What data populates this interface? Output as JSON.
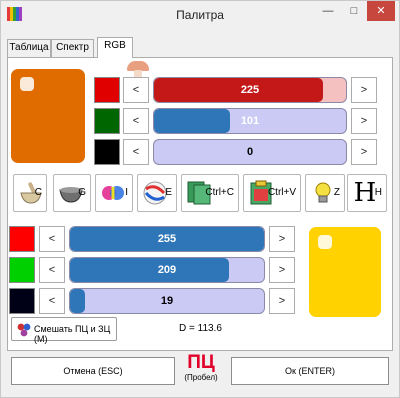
{
  "window": {
    "title": "Палитра",
    "minimize_glyph": "—",
    "maximize_glyph": "□",
    "close_glyph": "✕"
  },
  "tabs": [
    {
      "label": "Таблица",
      "active": false
    },
    {
      "label": "Спектр",
      "active": false
    },
    {
      "label": "RGB",
      "active": true
    }
  ],
  "primary": {
    "swatch_color": "#e06c00",
    "channels": [
      {
        "name": "red",
        "swatch_color": "#e00000",
        "value": "225",
        "fraction": 0.882,
        "fill_color": "#c41818",
        "track_color": "#f4c0c0",
        "text_color": "#ffffff"
      },
      {
        "name": "green",
        "swatch_color": "#006600",
        "value": "101",
        "fraction": 0.396,
        "fill_color": "#2e76b8",
        "track_color": "#cacaf4",
        "text_color": "#ffffff"
      },
      {
        "name": "blue",
        "swatch_color": "#000000",
        "value": "0",
        "fraction": 0.0,
        "fill_color": "#2e76b8",
        "track_color": "#cacaf4",
        "text_color": "#000000"
      }
    ]
  },
  "secondary": {
    "swatch_color": "#ffd200",
    "channels": [
      {
        "name": "red",
        "swatch_color": "#ff0000",
        "value": "255",
        "fraction": 1.0,
        "fill_color": "#2e76b8",
        "track_color": "#cacaf4",
        "text_color": "#ffffff"
      },
      {
        "name": "green",
        "swatch_color": "#00d000",
        "value": "209",
        "fraction": 0.82,
        "fill_color": "#2e76b8",
        "track_color": "#cacaf4",
        "text_color": "#ffffff"
      },
      {
        "name": "blue",
        "swatch_color": "#000016",
        "value": "19",
        "fraction": 0.075,
        "fill_color": "#2e76b8",
        "track_color": "#cacaf4",
        "text_color": "#000000"
      }
    ]
  },
  "arrows": {
    "left": "<",
    "right": ">"
  },
  "tools": [
    {
      "icon": "mortar-pestle-icon",
      "label": "C"
    },
    {
      "icon": "bowl-icon",
      "label": "G"
    },
    {
      "icon": "color-circles-icon",
      "label": "I"
    },
    {
      "icon": "swap-arrows-icon",
      "label": "E"
    },
    {
      "icon": "copy-icon",
      "label": "Ctrl+C"
    },
    {
      "icon": "paste-icon",
      "label": "Ctrl+V"
    },
    {
      "icon": "lightbulb-icon",
      "label": "Z"
    },
    {
      "icon": "letter-h-icon",
      "label": "H",
      "glyph": "H"
    }
  ],
  "mix_button": {
    "label": "Смешать ПЦ и ЗЦ (M)",
    "icon": "blend-dots-icon"
  },
  "distance": "D = 113.6",
  "cancel_button": "Отмена (ESC)",
  "ok_button": "Ок (ENTER)",
  "primary_indicator": {
    "big": "ПЦ",
    "small": "(Пробел)"
  }
}
